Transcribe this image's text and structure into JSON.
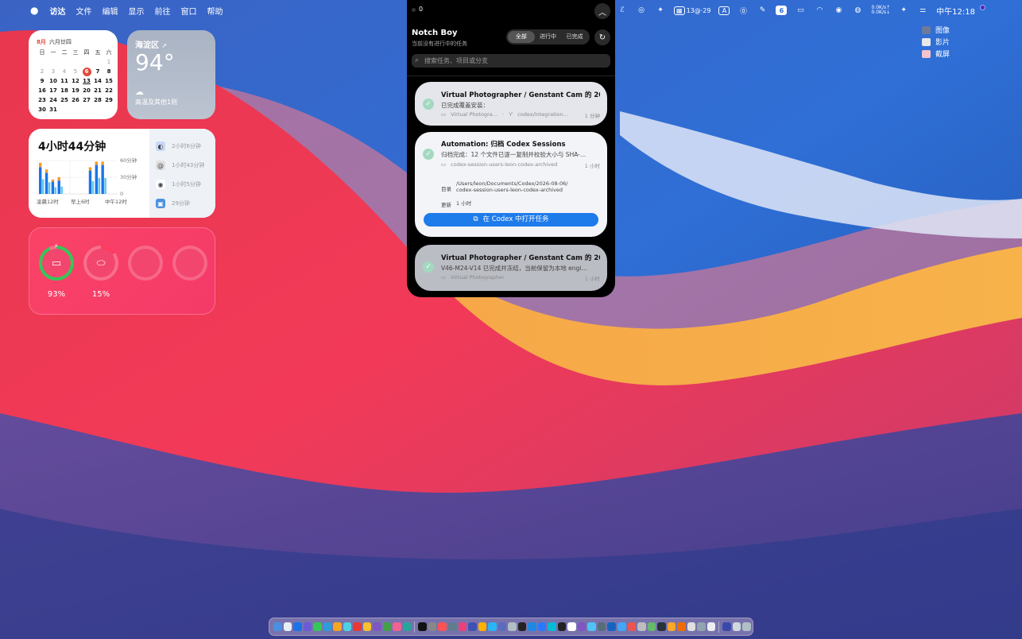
{
  "menubar": {
    "apple": "",
    "app_name": "访达",
    "menus": [
      "文件",
      "编辑",
      "显示",
      "前往",
      "窗口",
      "帮助"
    ],
    "status": {
      "calendar_badge": "13@·29",
      "input_method": "A",
      "battery_num": "6",
      "net_up": "0.0K/s↑",
      "net_down": "0.0K/s↓",
      "clock": "中午12:18"
    }
  },
  "desktop_items": [
    "图像",
    "影片",
    "截屏"
  ],
  "calendar": {
    "month": "8月",
    "lunar": "六月廿四",
    "weekdays": [
      "日",
      "一",
      "二",
      "三",
      "四",
      "五",
      "六"
    ],
    "days": [
      "",
      "",
      "",
      "",
      "",
      "",
      "1",
      "2",
      "3",
      "4",
      "5",
      "6",
      "7",
      "8",
      "9",
      "10",
      "11",
      "12",
      "13",
      "14",
      "15",
      "16",
      "17",
      "18",
      "19",
      "20",
      "21",
      "22",
      "23",
      "24",
      "25",
      "26",
      "27",
      "28",
      "29",
      "30",
      "31",
      "",
      "",
      "",
      "",
      ""
    ],
    "today": "6",
    "underlined": "13"
  },
  "weather": {
    "location": "海淀区",
    "temperature": "94°",
    "description": "高温及其他1则"
  },
  "screentime": {
    "total": "4小时44分钟",
    "y_labels": [
      "60分钟",
      "30分钟",
      "0"
    ],
    "x_labels": [
      "凌晨12时",
      "早上6时",
      "中午12时"
    ],
    "apps": [
      {
        "time": "2小时6分钟",
        "icon": "codex-app-icon",
        "color": "#c8d7f5"
      },
      {
        "time": "1小时43分钟",
        "icon": "terminal-app-icon",
        "color": "#e0e0e0"
      },
      {
        "time": "1小时5分钟",
        "icon": "chrome-app-icon",
        "color": "#ffffff"
      },
      {
        "time": "29分钟",
        "icon": "preview-app-icon",
        "color": "#4a90e2"
      }
    ]
  },
  "chart_data": {
    "type": "bar",
    "categories": [
      "h0",
      "h1",
      "h2",
      "h3",
      "h4",
      "h5",
      "h6",
      "h7",
      "h8",
      "h9",
      "h10",
      "h11",
      "h12"
    ],
    "series": [
      {
        "values": [
          48,
          38,
          22,
          24,
          0,
          0,
          0,
          0,
          42,
          52,
          52,
          0,
          0
        ]
      },
      {
        "values": [
          8,
          6,
          4,
          6,
          0,
          0,
          0,
          0,
          6,
          6,
          6,
          0,
          0
        ]
      }
    ],
    "ylim": [
      0,
      60
    ],
    "colors": {
      "primary": "#1a73e8",
      "secondary": "#f59b2b"
    }
  },
  "battery": [
    {
      "percent": "93%",
      "level": 0.93,
      "icon": "laptop-icon",
      "ring": "#34c759"
    },
    {
      "percent": "15%",
      "level": 0.15,
      "icon": "mouse-icon",
      "ring": "#ff3b5c"
    },
    {
      "percent": "",
      "level": 0,
      "icon": "",
      "ring": ""
    },
    {
      "percent": "",
      "level": 0,
      "icon": "",
      "ring": ""
    }
  ],
  "notch": {
    "count": "0",
    "title": "Notch Boy",
    "subtitle": "当前没有进行中的任务",
    "tabs": [
      "全部",
      "进行中",
      "已完成"
    ],
    "active_tab": 0,
    "search_placeholder": "搜索任务、项目或分支",
    "cards": [
      {
        "title": "Virtual Photographer / Genstant Cam 的 20…",
        "subtitle": "已完成覆盖安装：",
        "project": "Virtual Photogra…",
        "branch": "codex/integration…",
        "time": "1 分钟"
      },
      {
        "title": "Automation: 归档 Codex Sessions",
        "subtitle": "归档完成：12 个文件已逐一复制并校验大小与 SHA-…",
        "project": "codex-session-users-leon-codex-archived",
        "time": "1 小时",
        "dir_label": "目录",
        "dir_value_1": "/Users/leon/Documents/Codex/2026-08-06/",
        "dir_value_2": "codex-session-users-leon-codex-archived",
        "updated_label": "更新",
        "updated_value": "1 小时",
        "open_button": "在 Codex 中打开任务"
      },
      {
        "title": "Virtual Photographer / Genstant Cam 的 20…",
        "subtitle": "V46-M24-V14 已完成并冻结，当前保留为本地 engi…",
        "project": "Virtual Photographer",
        "time": "1 小时"
      }
    ]
  }
}
